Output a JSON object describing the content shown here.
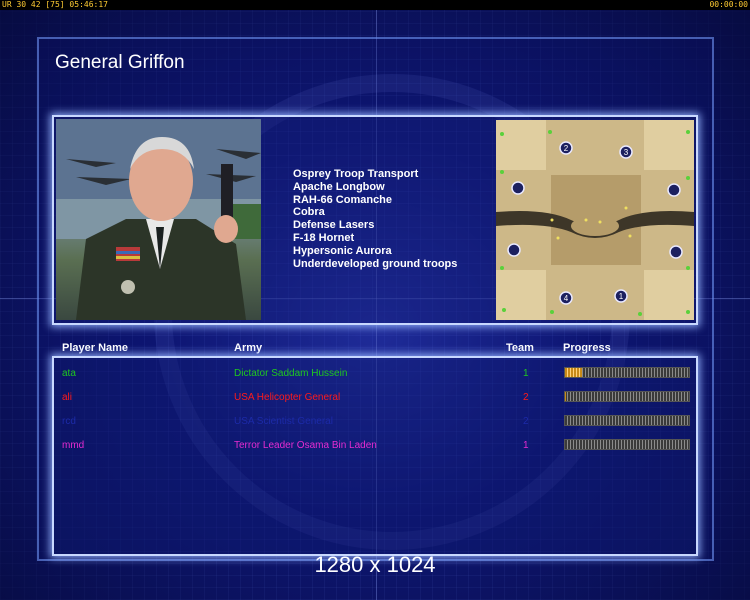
{
  "topbar": {
    "left_text": "UR 30 42 [75] 05:46:17",
    "right_text": "00:00:00"
  },
  "title": "General Griffon",
  "units": [
    "Osprey Troop Transport",
    "Apache Longbow",
    "RAH-66 Comanche",
    "Cobra",
    "Defense Lasers",
    "F-18 Hornet",
    "Hypersonic Aurora",
    "Underdeveloped ground troops"
  ],
  "columns": {
    "player": "Player Name",
    "army": "Army",
    "team": "Team",
    "progress": "Progress"
  },
  "players": [
    {
      "name": "ata",
      "army": "Dictator Saddam Hussein",
      "team": "1",
      "color": "#1fc81f",
      "progress": 0.14
    },
    {
      "name": "ali",
      "army": "USA Helicopter General",
      "team": "2",
      "color": "#ff1a1a",
      "progress": 0.01
    },
    {
      "name": "rcd",
      "army": "USA Scientist General",
      "team": "2",
      "color": "#1c2aa8",
      "progress": 0.0
    },
    {
      "name": "mmd",
      "army": "Terror Leader Osama Bin Laden",
      "team": "1",
      "color": "#e62bd0",
      "progress": 0.0
    }
  ],
  "minimap": {
    "start_positions": [
      "1",
      "2",
      "3",
      "4"
    ]
  },
  "resolution": "1280 x 1024"
}
